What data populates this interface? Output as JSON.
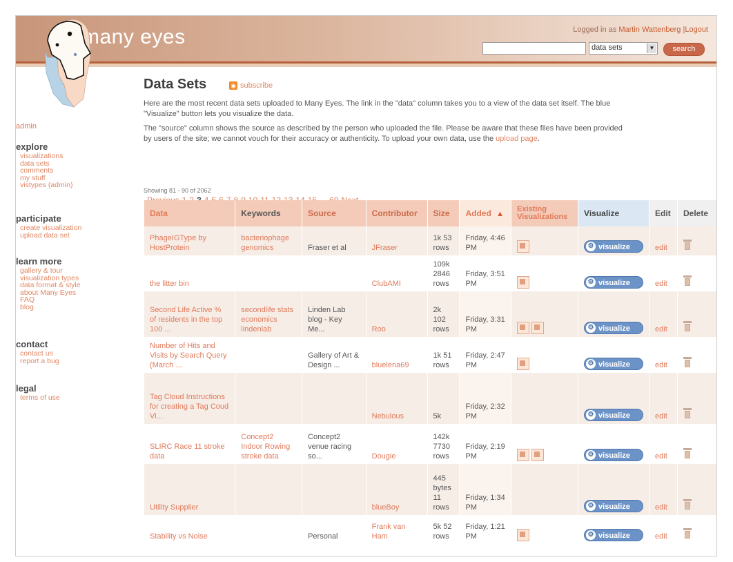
{
  "header": {
    "brand": "many eyes",
    "login_prefix": "Logged in as",
    "login_user": "Martin Wattenberg",
    "login_separator": "|",
    "logout": "Logout",
    "search_placeholder": "",
    "search_scope": "data sets",
    "search_button": "search"
  },
  "sidebar": {
    "admin": "admin",
    "sections": [
      {
        "title": "explore",
        "items": [
          "visualizations",
          "data sets",
          "comments",
          "my stuff",
          "vistypes (admin)"
        ]
      },
      {
        "title": "participate",
        "items": [
          "create visualization",
          "upload data set"
        ]
      },
      {
        "title": "learn more",
        "items": [
          "gallery & tour",
          "visualization types",
          "data format & style",
          "about Many Eyes",
          "FAQ",
          "blog"
        ]
      },
      {
        "title": "contact",
        "items": [
          "contact us",
          "report a bug"
        ]
      },
      {
        "title": "legal",
        "items": [
          "terms of use"
        ]
      }
    ]
  },
  "main": {
    "title": "Data Sets",
    "subscribe": "subscribe",
    "para1": "Here are the most recent data sets uploaded to Many Eyes. The link in the \"data\" column takes you to a view of the data set itself. The blue \"Visualize\" button lets you visualize the data.",
    "para2_text": "The \"source\" column shows the source as described by the person who uploaded the file. Please be aware that these files have been provided by users of the site; we cannot vouch for their accuracy or authenticity. To upload your own data, use the",
    "para2_link": "upload page",
    "para2_end": ".",
    "showing": "Showing 81 - 90 of 2062",
    "pager": [
      "Previous",
      "1",
      "2",
      "3",
      "4",
      "5",
      "6",
      "7",
      "8",
      "9",
      "10",
      "11",
      "12",
      "13",
      "14",
      "15",
      "...",
      "69",
      "Next"
    ],
    "current_page": "3"
  },
  "table": {
    "headers": {
      "data": "Data",
      "keywords": "Keywords",
      "source": "Source",
      "contributor": "Contributor",
      "size": "Size",
      "added": "Added",
      "existing": "Existing Visualizations",
      "visualize": "Visualize",
      "edit": "Edit",
      "delete": "Delete"
    },
    "sort_arrow": "▲",
    "visualize_label": "visualize",
    "edit_label": "edit",
    "rows": [
      {
        "data": "PhageIGType by HostProtein",
        "keywords": "bacteriophage genomics",
        "source": "Fraser et al",
        "contributor": "JFraser",
        "size": "1k 53 rows",
        "added": "Friday, 4:46 PM",
        "thumbs": 1
      },
      {
        "data": "the litter bin",
        "keywords": "",
        "source": "",
        "contributor": "ClubAMI",
        "size": "109k 2846 rows",
        "added": "Friday, 3:51 PM",
        "thumbs": 1
      },
      {
        "data": "Second Life Active % of residents in the top 100 ...",
        "keywords": "secondlife stats economics lindenlab",
        "source": "Linden Lab blog - Key Me...",
        "contributor": "Roo",
        "size": "2k 102 rows",
        "added": "Friday, 3:31 PM",
        "thumbs": 2
      },
      {
        "data": "Number of Hits and Visits by Search Query (March ...",
        "keywords": "",
        "source": "Gallery of Art & Design ...",
        "contributor": "bluelena69",
        "size": "1k 51 rows",
        "added": "Friday, 2:47 PM",
        "thumbs": 1
      },
      {
        "data": "Tag Cloud Instructions for creating a Tag Coud Vi...",
        "keywords": "",
        "source": "",
        "contributor": "Nebulous",
        "size": "5k",
        "added": "Friday, 2:32 PM",
        "thumbs": 0
      },
      {
        "data": "SLIRC Race 11 stroke data",
        "keywords": "Concept2 Indoor Rowing stroke data",
        "source": "Concept2 venue racing so...",
        "contributor": "Dougie",
        "size": "142k 7730 rows",
        "added": "Friday, 2:19 PM",
        "thumbs": 2
      },
      {
        "data": "Utility Supplier",
        "keywords": "",
        "source": "",
        "contributor": "blueBoy",
        "size": "445 bytes 11 rows",
        "added": "Friday, 1:34 PM",
        "thumbs": 0
      },
      {
        "data": "Stability vs Noise",
        "keywords": "",
        "source": "Personal",
        "contributor": "Frank van Ham",
        "size": "5k 52 rows",
        "added": "Friday, 1:21 PM",
        "thumbs": 1
      }
    ]
  }
}
